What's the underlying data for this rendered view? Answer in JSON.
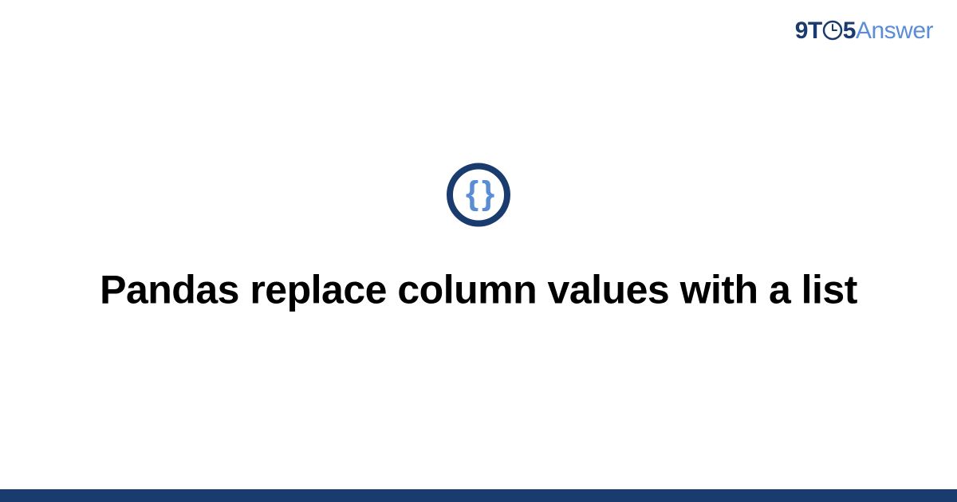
{
  "brand": {
    "part1": "9T",
    "part2": "5",
    "part3": "Answer"
  },
  "icon": {
    "braces": "{ }"
  },
  "title": "Pandas replace column values with a list",
  "colors": {
    "primary": "#1a3b6e",
    "accent": "#5b8dd6"
  }
}
